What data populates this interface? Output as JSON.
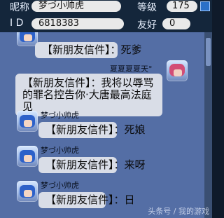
{
  "header": {
    "nickname_label": "昵称",
    "nickname_value": "梦づ小帅虎",
    "level_label": "等级",
    "level_value": "175",
    "id_label": "I D",
    "id_value": "6818383",
    "friend_label": "友好",
    "friend_value": "0"
  },
  "chat": {
    "messages": [
      {
        "side": "left",
        "name": "",
        "text": "【新朋友信件】：死爹"
      },
      {
        "side": "right",
        "name": "夏夏夏夏天°",
        "text": "【新朋友信件】：我将以辱骂的罪名控告你·大唐最高法庭见"
      },
      {
        "side": "left",
        "name": "梦づ小帅虎",
        "text": "【新朋友信件】：死娘"
      },
      {
        "side": "left",
        "name": "梦づ小帅虎",
        "text": "【新朋友信件】：来呀"
      },
      {
        "side": "left",
        "name": "梦づ小帅虎",
        "text": "【新朋友信件】：日"
      }
    ]
  },
  "watermark": "头条号 / 我的游戏",
  "colors": {
    "chat_bg": "#546ea5",
    "bubble_bg": "#d9dde7",
    "header_bg": "#14263b"
  }
}
